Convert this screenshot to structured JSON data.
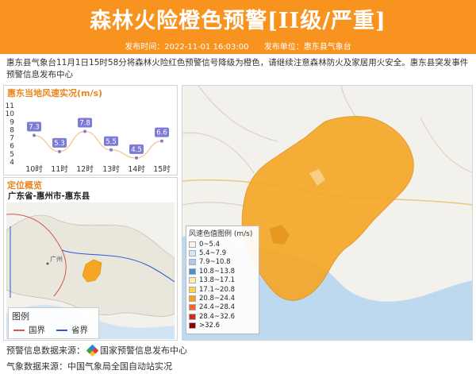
{
  "header": {
    "title": "森林火险橙色预警[II级/严重]",
    "publish_time_label": "发布时间：2022-11-01 16:03:00",
    "publisher_label": "发布单位：惠东县气象台"
  },
  "description": "惠东县气象台11月1日15时58分将森林火险红色预警信号降级为橙色，请继续注意森林防火及家居用火安全。惠东县突发事件预警信息发布中心",
  "wind_panel": {
    "title": "惠东当地风速实况(m/s)",
    "y_ticks": [
      "11",
      "10",
      "9",
      "8",
      "7",
      "6",
      "5",
      "4"
    ],
    "colors": {
      "line": "#f5c9a0",
      "badge": "#7e7bd6"
    }
  },
  "chart_data": {
    "type": "line",
    "title": "惠东当地风速实况(m/s)",
    "categories": [
      "10时",
      "11时",
      "12时",
      "13时",
      "14时",
      "15时"
    ],
    "values": [
      7.3,
      5.3,
      7.8,
      5.5,
      4.5,
      6.6
    ],
    "ylim": [
      4,
      11
    ],
    "grid": false
  },
  "location": {
    "title": "定位概览",
    "subtitle": "广东省-惠州市-惠东县",
    "map_label": "广州",
    "legend_title": "图例",
    "legend_items": [
      {
        "label": "国界",
        "color": "#d9534f"
      },
      {
        "label": "省界",
        "color": "#2a5bd7"
      }
    ]
  },
  "map": {
    "legend_title": "风速色值图例 (m/s)",
    "region_color": "#f5a623",
    "legend_items": [
      {
        "label": "0~5.4",
        "color": "#f4f4f4"
      },
      {
        "label": "5.4~7.9",
        "color": "#d6e7f7"
      },
      {
        "label": "7.9~10.8",
        "color": "#a9cdee"
      },
      {
        "label": "10.8~13.8",
        "color": "#4a90d9"
      },
      {
        "label": "13.8~17.1",
        "color": "#fff2a8"
      },
      {
        "label": "17.1~20.8",
        "color": "#ffd24d"
      },
      {
        "label": "20.8~24.4",
        "color": "#f7a11a"
      },
      {
        "label": "24.4~28.4",
        "color": "#f26522"
      },
      {
        "label": "28.4~32.6",
        "color": "#d7261e"
      },
      {
        "label": ">32.6",
        "color": "#8b0000"
      }
    ]
  },
  "footer": {
    "warning_source_label": "预警信息数据来源：",
    "warning_source_name": "国家预警信息发布中心",
    "weather_source": "气象数据来源：中国气象局全国自动站实况"
  }
}
